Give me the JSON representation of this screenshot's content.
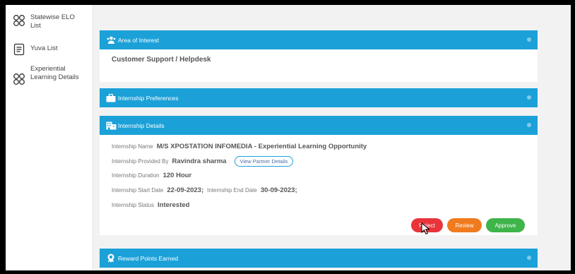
{
  "sidebar": {
    "items": [
      {
        "label": "Statewise ELO List",
        "icon": "grid-icon"
      },
      {
        "label": "Yuva List",
        "icon": "list-icon"
      },
      {
        "label": "Experiential Learning Details",
        "icon": "grid-icon"
      }
    ]
  },
  "area_of_interest": {
    "title": "Area of Interest",
    "value": "Customer Support / Helpdesk"
  },
  "internship_preferences": {
    "title": "Internship Preferences"
  },
  "internship_details": {
    "title": "Internship Details",
    "name_label": "Internship Name",
    "name_value": "M/S XPOSTATION INFOMEDIA - Experiential Learning Opportunity",
    "provided_label": "Internship Provided By",
    "provided_value": "Ravindra sharma",
    "partner_button": "View Partner Details",
    "duration_label": "Internship Duration",
    "duration_value": "120 Hour",
    "start_label": "Internship Start Date",
    "start_value": "22-09-2023;",
    "end_label": "Internship End Date",
    "end_value": "30-09-2023;",
    "status_label": "Internship Status",
    "status_value": "Interested"
  },
  "actions": {
    "reject": "Reject",
    "review": "Review",
    "approve": "Approve"
  },
  "reward_points": {
    "title": "Reward Points Earned"
  },
  "colors": {
    "header_blue": "#1ba1d8",
    "reject": "#e8343a",
    "review": "#f07b1e",
    "approve": "#3fb44a"
  }
}
